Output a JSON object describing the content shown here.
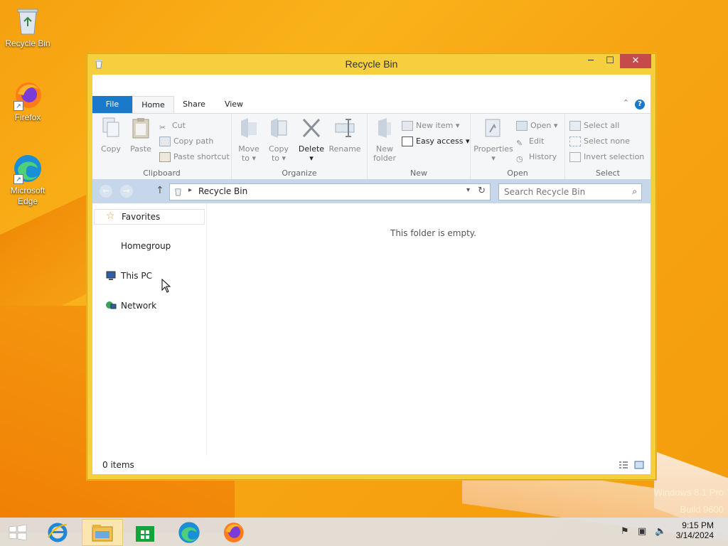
{
  "desktop": {
    "icons": [
      {
        "label": "Recycle Bin"
      },
      {
        "label": "Firefox"
      },
      {
        "label": "Microsoft Edge"
      }
    ],
    "watermark_line1": "Windows 8.1 Pro",
    "watermark_line2": "Build 9600"
  },
  "window": {
    "title": "Recycle Bin",
    "tabs": [
      "File",
      "Home",
      "Share",
      "View"
    ],
    "ribbon": {
      "clipboard": {
        "label": "Clipboard",
        "copy": "Copy",
        "paste": "Paste",
        "cut": "Cut",
        "copy_path": "Copy path",
        "paste_shortcut": "Paste shortcut"
      },
      "organize": {
        "label": "Organize",
        "move_to": "Move",
        "move_to2": "to",
        "copy_to": "Copy",
        "copy_to2": "to",
        "delete": "Delete",
        "rename": "Rename"
      },
      "new": {
        "label": "New",
        "new_folder": "New",
        "new_folder2": "folder",
        "new_item": "New item",
        "easy_access": "Easy access"
      },
      "open": {
        "label": "Open",
        "properties": "Properties",
        "open": "Open",
        "edit": "Edit",
        "history": "History"
      },
      "select": {
        "label": "Select",
        "select_all": "Select all",
        "select_none": "Select none",
        "invert": "Invert selection"
      }
    },
    "address": {
      "path": "Recycle Bin",
      "search_placeholder": "Search Recycle Bin"
    },
    "nav": [
      "Favorites",
      "Homegroup",
      "This PC",
      "Network"
    ],
    "empty_message": "This folder is empty.",
    "status": "0 items"
  },
  "taskbar": {
    "time": "9:15 PM",
    "date": "3/14/2024"
  },
  "colors": {
    "accent": "#1979ca",
    "window_frame": "#f5cf3e",
    "close": "#c74a4a"
  }
}
